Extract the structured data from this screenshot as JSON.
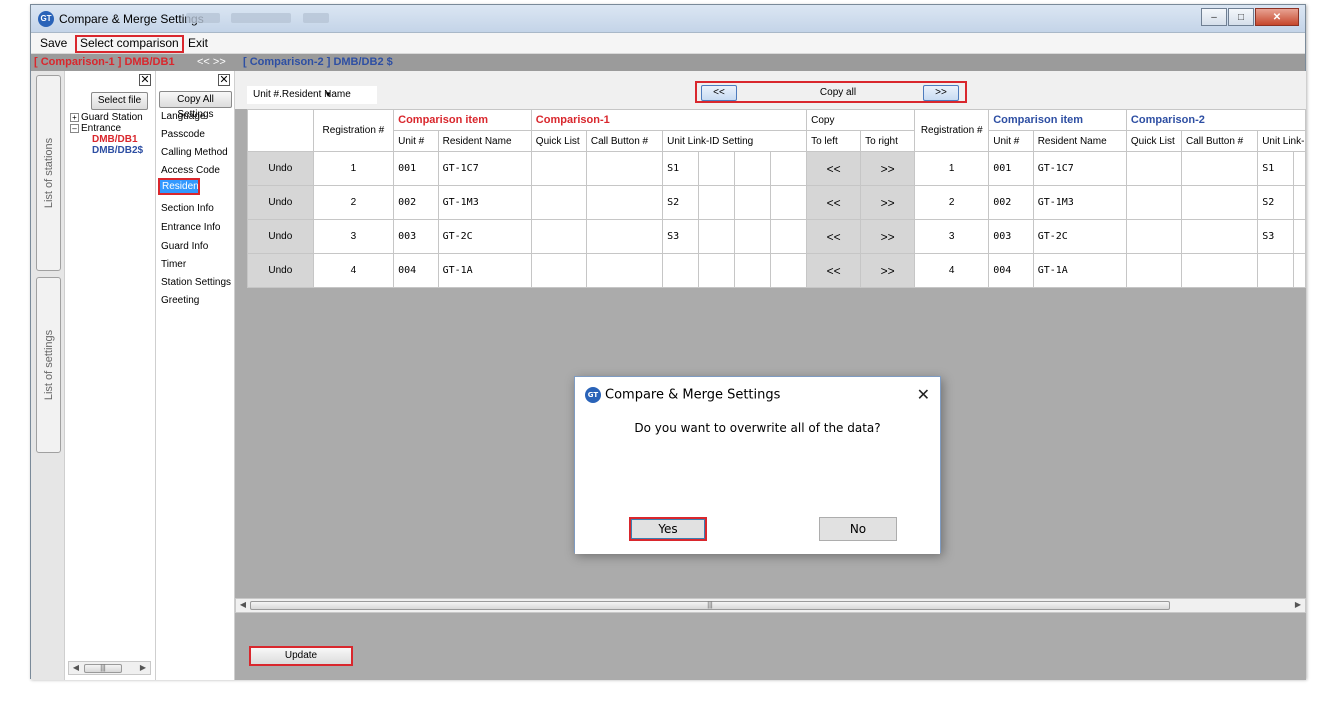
{
  "window": {
    "title": "Compare & Merge Settings"
  },
  "menu": {
    "save": "Save",
    "select_comparison": "Select comparison",
    "exit": "Exit"
  },
  "compbar": {
    "left": "[ Comparison-1 ] DMB/DB1",
    "arrows": "<< >>",
    "right": "[ Comparison-2 ] DMB/DB2 $"
  },
  "left_tabs": {
    "stations": "List of stations",
    "settings": "List of settings"
  },
  "stations_panel": {
    "select_file": "Select file",
    "tree": {
      "guard_station": "Guard Station",
      "entrance": "Entrance",
      "db1": "DMB/DB1",
      "db2": "DMB/DB2$"
    }
  },
  "settings_panel": {
    "copy_all": "Copy All Settings",
    "items": [
      "Language",
      "Passcode",
      "Calling Method",
      "Access Code",
      "Resident",
      "Section Info",
      "Entrance Info",
      "Guard Info",
      "Timer",
      "Station Settings",
      "Greeting"
    ]
  },
  "toolbar": {
    "dropdown_value": "Unit #.Resident Name",
    "copy_left": "<<",
    "copy_all": "Copy all",
    "copy_right": ">>"
  },
  "grid": {
    "group_headers": {
      "comparison_item_1": "Comparison item",
      "comparison_1": "Comparison-1",
      "copy": "Copy",
      "comparison_item_2": "Comparison item",
      "comparison_2": "Comparison-2"
    },
    "col_headers": {
      "registration": "Registration #",
      "unit": "Unit #",
      "resident_name": "Resident Name",
      "quick_list": "Quick List",
      "call_button": "Call Button #",
      "unit_link": "Unit Link-ID Setting",
      "to_left": "To left",
      "to_right": "To right",
      "unit_link_2": "Unit Link-ID Set"
    },
    "rows": [
      {
        "undo": "Undo",
        "reg": "1",
        "unit": "001",
        "name": "GT-1C7",
        "link": "S1",
        "left": "<<",
        "right": ">>",
        "reg2": "1",
        "unit2": "001",
        "name2": "GT-1C7",
        "link2": "S1"
      },
      {
        "undo": "Undo",
        "reg": "2",
        "unit": "002",
        "name": "GT-1M3",
        "link": "S2",
        "left": "<<",
        "right": ">>",
        "reg2": "2",
        "unit2": "002",
        "name2": "GT-1M3",
        "link2": "S2"
      },
      {
        "undo": "Undo",
        "reg": "3",
        "unit": "003",
        "name": "GT-2C",
        "link": "S3",
        "left": "<<",
        "right": ">>",
        "reg2": "3",
        "unit2": "003",
        "name2": "GT-2C",
        "link2": "S3"
      },
      {
        "undo": "Undo",
        "reg": "4",
        "unit": "004",
        "name": "GT-1A",
        "link": "",
        "left": "<<",
        "right": ">>",
        "reg2": "4",
        "unit2": "004",
        "name2": "GT-1A",
        "link2": ""
      }
    ]
  },
  "update_button": "Update",
  "dialog": {
    "title": "Compare & Merge Settings",
    "message": "Do you want to overwrite all of the data?",
    "yes": "Yes",
    "no": "No"
  },
  "icons": {
    "app": "gt-app-icon",
    "close": "close-icon"
  },
  "colors": {
    "comparison1": "#d9272d",
    "comparison2": "#2e4fa3",
    "highlight_box": "#d9272d",
    "selected": "#3399ff"
  }
}
